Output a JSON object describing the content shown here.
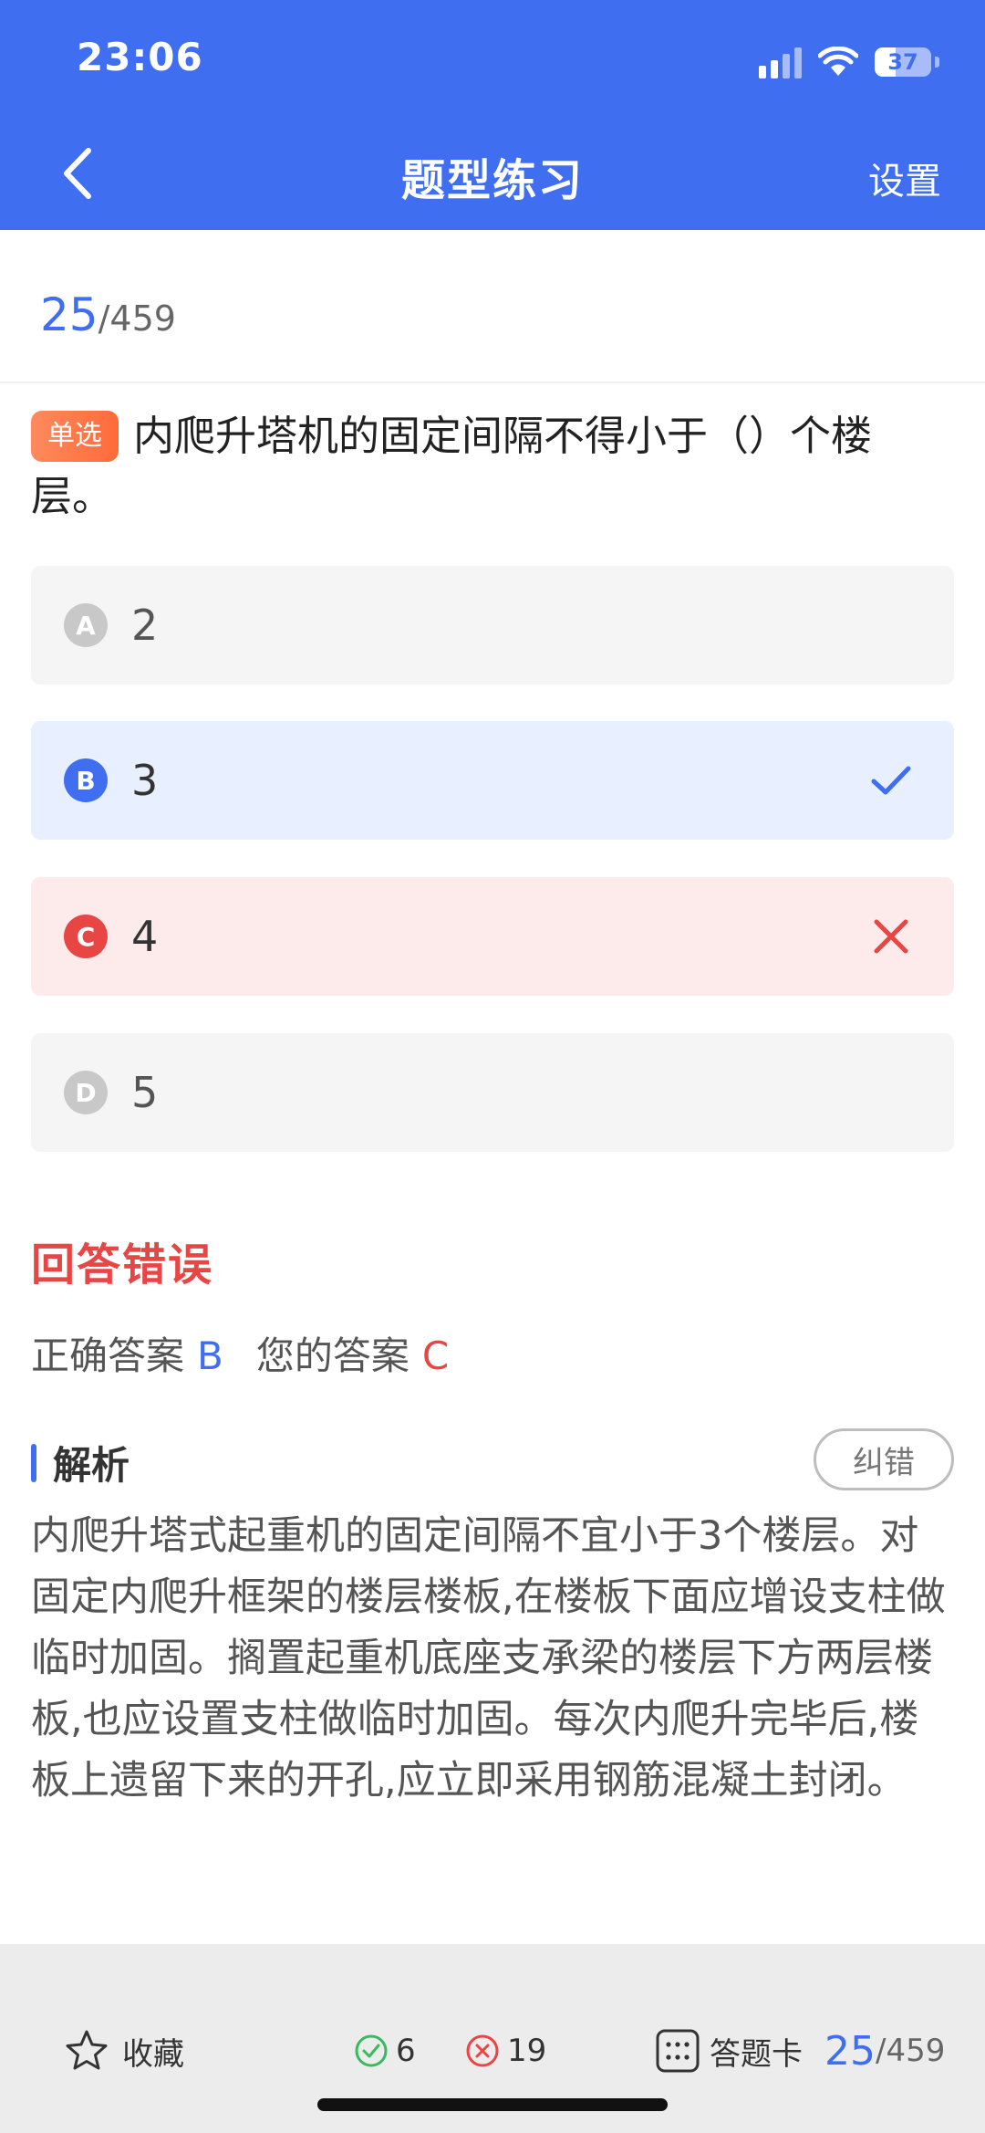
{
  "status_bar": {
    "time": "23:06",
    "battery": "37",
    "battery_level": 0.37
  },
  "nav": {
    "title": "题型练习",
    "settings_label": "设置"
  },
  "progress": {
    "current": "25",
    "total": "/459"
  },
  "question": {
    "type_tag": "单选",
    "text": "内爬升塔机的固定间隔不得小于（）个楼层。"
  },
  "options": [
    {
      "letter": "A",
      "text": "2",
      "state": "normal"
    },
    {
      "letter": "B",
      "text": "3",
      "state": "correct"
    },
    {
      "letter": "C",
      "text": "4",
      "state": "wrong"
    },
    {
      "letter": "D",
      "text": "5",
      "state": "normal"
    }
  ],
  "result": {
    "title": "回答错误",
    "correct_label": "正确答案",
    "correct_value": "B",
    "your_label": "您的答案",
    "your_value": "C"
  },
  "analysis": {
    "title": "解析",
    "report_label": "纠错",
    "text": "内爬升塔式起重机的固定间隔不宜小于3个楼层。对固定内爬升框架的楼层楼板,在楼板下面应增设支柱做临时加固。搁置起重机底座支承梁的楼层下方两层楼板,也应设置支柱做临时加固。每次内爬升完毕后,楼板上遗留下来的开孔,应立即采用钢筋混凝土封闭。"
  },
  "bottom_bar": {
    "favorite_label": "收藏",
    "right_count": "6",
    "wrong_count": "19",
    "answer_card_label": "答题卡",
    "progress_current": "25",
    "progress_total": "/459"
  },
  "colors": {
    "primary": "#3f6ef0",
    "error": "#e84545",
    "correct_bg": "#e8efff",
    "wrong_bg": "#fdeaea",
    "tag_orange": "#ff6a3a"
  }
}
